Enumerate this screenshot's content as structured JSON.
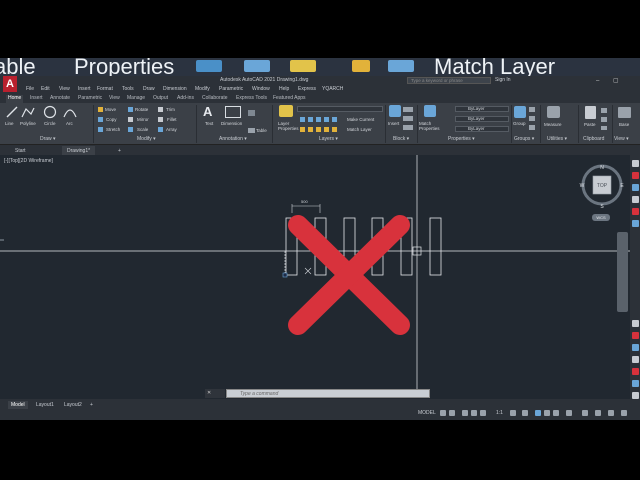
{
  "banner": {
    "items": [
      "able",
      "Properties",
      "Match Layer"
    ]
  },
  "titlebar": {
    "logo": "A",
    "title": "Autodesk AutoCAD 2021   Drawing1.dwg",
    "search_placeholder": "Type a keyword or phrase",
    "signin": "Sign In"
  },
  "menubar": {
    "items": [
      "File",
      "Edit",
      "View",
      "Insert",
      "Format",
      "Tools",
      "Draw",
      "Dimension",
      "Modify",
      "Parametric",
      "Window",
      "Help",
      "Express",
      "YQARCH"
    ]
  },
  "ribbon_tabs": {
    "items": [
      "Home",
      "Insert",
      "Annotate",
      "Parametric",
      "View",
      "Manage",
      "Output",
      "Add-ins",
      "Collaborate",
      "Express Tools",
      "Featured Apps"
    ]
  },
  "ribbon": {
    "draw": {
      "title": "Draw ▾",
      "line": "Line",
      "polyline": "Polyline",
      "circle": "Circle",
      "arc": "Arc"
    },
    "modify": {
      "title": "Modify ▾",
      "move": "Move",
      "rotate": "Rotate",
      "trim": "Trim",
      "copy": "Copy",
      "mirror": "Mirror",
      "fillet": "Fillet",
      "stretch": "Stretch",
      "scale": "Scale",
      "array": "Array"
    },
    "annotation": {
      "title": "Annotation ▾",
      "text": "Text",
      "dimension": "Dimension",
      "table": "Table"
    },
    "layers": {
      "title": "Layers ▾",
      "layer_properties": "Layer Properties",
      "make_current": "Make Current",
      "match_layer": "Match Layer"
    },
    "block": {
      "title": "Block ▾",
      "insert": "Insert"
    },
    "properties": {
      "title": "Properties ▾",
      "match_properties": "Match Properties",
      "bylayer1": "ByLayer",
      "bylayer2": "ByLayer",
      "bylayer3": "ByLayer"
    },
    "groups": {
      "title": "Groups ▾",
      "group": "Group"
    },
    "utilities": {
      "title": "Utilities ▾",
      "measure": "Measure"
    },
    "clipboard": {
      "title": "Clipboard",
      "paste": "Paste"
    },
    "view": {
      "title": "View ▾",
      "base": "Base"
    }
  },
  "file_tabs": {
    "start": "Start",
    "drawing": "Drawing1*",
    "add": "+"
  },
  "viewport": {
    "label": "[-][Top][2D Wireframe]",
    "viewcube": {
      "top": "TOP",
      "n": "N",
      "s": "S",
      "e": "E",
      "w": "W",
      "wcs": "WCS"
    },
    "dimension_text": "500"
  },
  "overlay": {
    "color": "#d8323c"
  },
  "command": {
    "placeholder": "Type a command",
    "close": "✕"
  },
  "layout_tabs": [
    "Model",
    "Layout1",
    "Layout2",
    "+"
  ],
  "status": {
    "model": "MODEL",
    "scale": "1:1"
  }
}
